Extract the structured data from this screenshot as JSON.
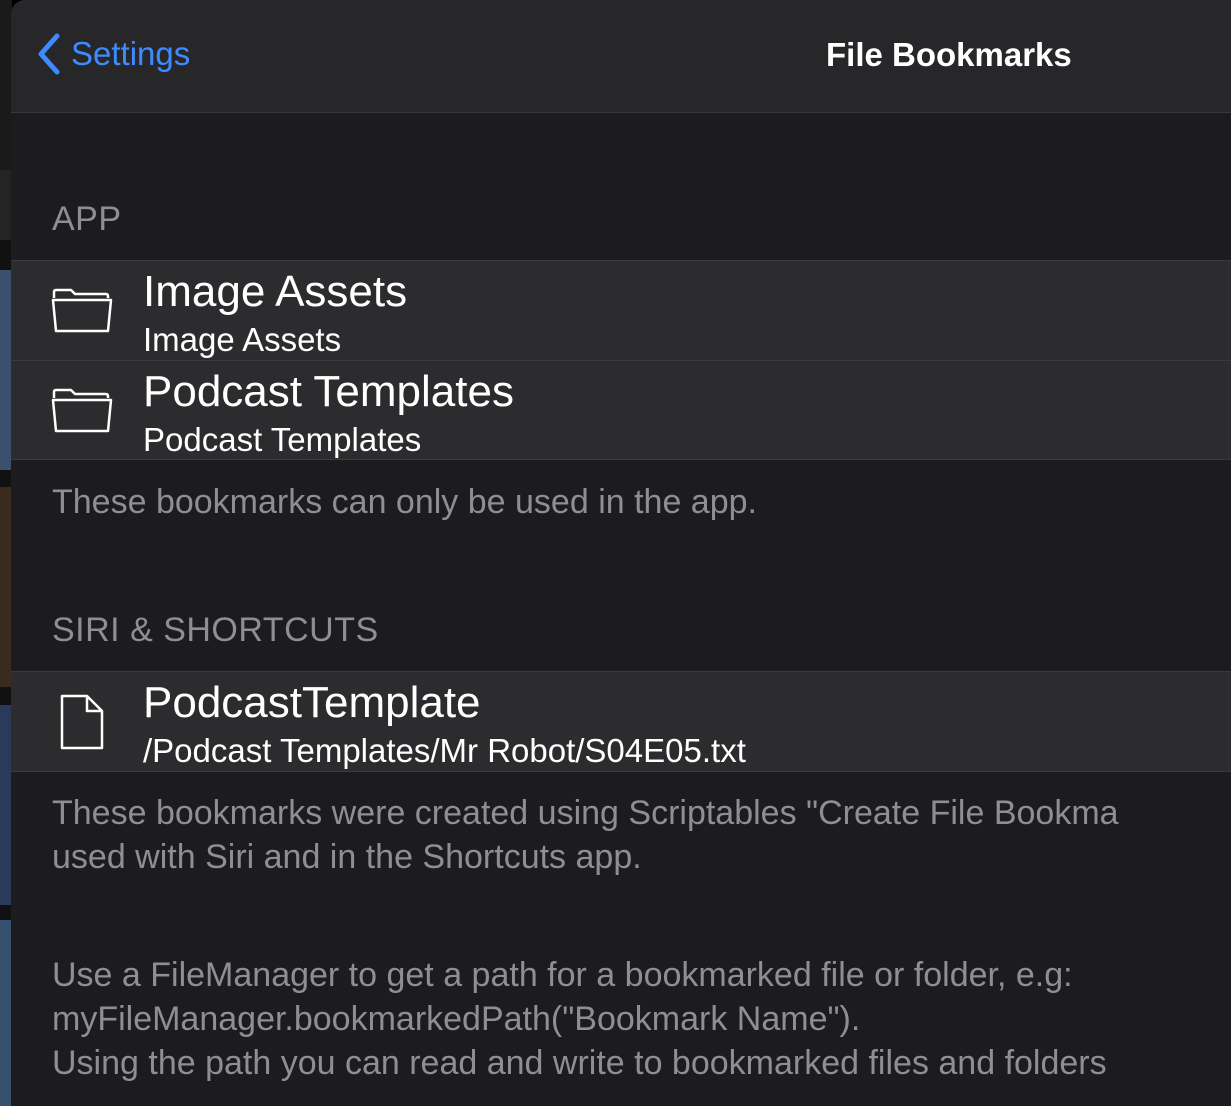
{
  "nav": {
    "back_label": "Settings",
    "title": "File Bookmarks"
  },
  "sections": {
    "app": {
      "header": "APP",
      "items": [
        {
          "title": "Image Assets",
          "subtitle": "Image Assets",
          "icon": "folder-icon"
        },
        {
          "title": "Podcast Templates",
          "subtitle": "Podcast Templates",
          "icon": "folder-icon"
        }
      ],
      "footer": "These bookmarks can only be used in the app."
    },
    "shortcuts": {
      "header": "SIRI & SHORTCUTS",
      "items": [
        {
          "title": "PodcastTemplate",
          "subtitle": "/Podcast Templates/Mr Robot/S04E05.txt",
          "icon": "document-icon"
        }
      ],
      "footer_line1": "These bookmarks were created using Scriptables \"Create File Bookma",
      "footer_line2": "used with Siri and in the Shortcuts app."
    }
  },
  "help": {
    "line1": "Use a FileManager to get a path for a bookmarked file or folder, e.g:",
    "line2": "myFileManager.bookmarkedPath(\"Bookmark Name\").",
    "line3": "Using the path you can read and write to bookmarked files and folders"
  },
  "colors": {
    "accent": "#3d8bff",
    "background": "#1c1c1e",
    "cell": "#2c2c2e",
    "secondary_text": "#8e8e93"
  }
}
